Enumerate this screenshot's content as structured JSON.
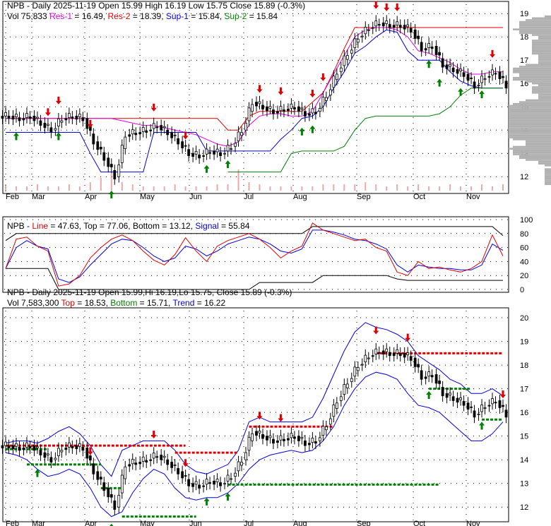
{
  "panel1": {
    "line1": {
      "title": "NPB - Daily 2025-11-19",
      "open": "Open 15.99",
      "high": "High 16.19",
      "low": "Low 15.75",
      "close": "Close 15.89 (-0.3%)"
    },
    "line2": {
      "vol": "Vol 75,833",
      "res1_label": "Res-1",
      "res1": "= 16.49,",
      "res2_label": "Res-2",
      "res2": "= 18.39,",
      "sup1_label": "Sup-1",
      "sup1": "= 15.84,",
      "sup2_label": "Sup-2",
      "sup2": "= 15.84"
    }
  },
  "panel2": {
    "prefix": "NPB -",
    "line_label": "Line",
    "line": "= 47.63,",
    "rest": "Top = 77.06, Bottom = 13.12,",
    "signal_label": "Signal",
    "signal": "= 55.84"
  },
  "panel3": {
    "line1": "NPB - Daily 2025-11-19 Open 15.99,Hi 16.19,Lo 15.75, Close 15.89 (-0.3%)",
    "line2": {
      "vol": "Vol 7,583,300",
      "top_label": "Top",
      "top": "= 18.53,",
      "bottom_label": "Bottom",
      "bottom": "= 15.71,",
      "trend_label": "Trend",
      "trend": "= 16.22"
    }
  },
  "colors": {
    "up": "#000000",
    "down": "#000000",
    "res1": "#e000e0",
    "res2": "#e00000",
    "sup1": "#0000e0",
    "sup2": "#008000",
    "line": "#e00000",
    "signal": "#0000e0",
    "arrow_up": "#008000",
    "arrow_down": "#e00000",
    "volume": "#c0c0c0"
  },
  "chart_data": [
    {
      "type": "candlestick",
      "title": "NPB - Daily 2025-11-19",
      "x_tick_labels": [
        "Feb",
        "Mar",
        "Apr",
        "May",
        "Jun",
        "Jul",
        "Aug",
        "Sep",
        "Oct",
        "Nov"
      ],
      "y_ticks": [
        12,
        13,
        14,
        15,
        16,
        17,
        18,
        19
      ],
      "ylim": [
        11.4,
        19.4
      ],
      "closes": [
        14.6,
        14.5,
        14.6,
        14.3,
        14.0,
        14.5,
        14.6,
        14.5,
        13.5,
        12.8,
        12.0,
        13.8,
        13.9,
        14.0,
        14.2,
        13.9,
        13.5,
        13.0,
        12.9,
        13.1,
        13.0,
        13.3,
        14.0,
        15.2,
        15.0,
        14.8,
        14.9,
        15.0,
        14.7,
        14.8,
        15.5,
        16.5,
        17.3,
        18.0,
        18.4,
        18.6,
        18.5,
        18.5,
        18.3,
        17.5,
        17.6,
        16.8,
        16.6,
        16.4,
        15.9,
        16.3,
        16.5,
        15.9
      ],
      "volume": [
        3,
        2,
        2,
        3,
        2,
        2,
        3,
        2,
        4,
        6,
        9,
        4,
        3,
        2,
        2,
        2,
        3,
        2,
        2,
        2,
        3,
        3,
        10,
        4,
        3,
        2,
        2,
        2,
        2,
        2,
        3,
        3,
        3,
        3,
        4,
        3,
        2,
        3,
        2,
        3,
        2,
        2,
        3,
        2,
        2,
        3,
        2,
        3
      ],
      "res1": [
        14.5,
        14.5,
        14.5,
        14.5,
        14.5,
        14.5,
        14.5,
        14.5,
        14.5,
        14.5,
        14.5,
        14.4,
        14.3,
        14.2,
        14.2,
        14.1,
        14.0,
        13.9,
        13.8,
        13.6,
        13.4,
        13.3,
        13.5,
        14.2,
        14.6,
        14.7,
        14.7,
        14.6,
        14.6,
        14.8,
        15.6,
        16.4,
        17.2,
        18.0,
        18.3,
        18.4,
        18.4,
        18.3,
        18.0,
        17.4,
        17.3,
        17.1,
        16.9,
        16.6,
        16.4,
        16.4,
        16.5,
        16.5
      ],
      "res2": [
        14.5,
        14.5,
        14.5,
        14.5,
        14.5,
        14.5,
        14.5,
        14.5,
        14.5,
        14.5,
        14.5,
        14.5,
        14.5,
        14.5,
        14.5,
        14.5,
        14.5,
        14.5,
        14.5,
        14.5,
        14.5,
        14.0,
        14.0,
        14.6,
        14.8,
        14.8,
        14.8,
        14.8,
        14.8,
        15.2,
        15.6,
        16.5,
        17.5,
        18.4,
        18.4,
        18.4,
        18.4,
        18.4,
        18.4,
        18.4,
        18.4,
        18.4,
        18.4,
        18.4,
        18.4,
        18.4,
        18.4,
        18.4
      ],
      "sup1": [
        13.9,
        13.9,
        13.9,
        13.9,
        13.9,
        13.9,
        13.9,
        13.9,
        13.0,
        12.2,
        12.2,
        12.2,
        12.2,
        12.2,
        13.9,
        13.9,
        13.9,
        13.9,
        13.9,
        13.1,
        13.1,
        13.1,
        13.1,
        13.1,
        13.1,
        13.1,
        13.6,
        14.0,
        14.5,
        14.6,
        15.0,
        15.8,
        16.5,
        17.3,
        17.6,
        18.0,
        18.3,
        18.2,
        17.4,
        17.0,
        17.0,
        17.0,
        16.5,
        16.1,
        15.9,
        15.8,
        15.8,
        15.8
      ],
      "sup2": [
        null,
        null,
        null,
        null,
        null,
        null,
        null,
        null,
        null,
        null,
        null,
        null,
        null,
        null,
        null,
        null,
        null,
        null,
        null,
        null,
        null,
        12.2,
        12.2,
        12.2,
        12.2,
        12.2,
        12.2,
        13.0,
        13.1,
        13.1,
        13.1,
        13.1,
        13.3,
        14.0,
        14.5,
        14.6,
        14.6,
        14.6,
        14.6,
        14.6,
        14.6,
        14.7,
        15.0,
        15.5,
        15.8,
        15.8,
        15.8,
        15.8
      ],
      "buy_signals": [
        1,
        5,
        10,
        19,
        21,
        28,
        29,
        40,
        41,
        43,
        45
      ],
      "sell_signals": [
        4,
        5,
        8,
        14,
        17,
        24,
        26,
        29,
        30,
        35,
        36,
        37,
        46
      ]
    },
    {
      "type": "line",
      "y_ticks": [
        0,
        20,
        40,
        60,
        80,
        100
      ],
      "ylim": [
        0,
        100
      ],
      "series": [
        {
          "name": "Line",
          "values": [
            30,
            72,
            75,
            62,
            55,
            5,
            8,
            20,
            45,
            60,
            72,
            78,
            70,
            55,
            42,
            35,
            50,
            74,
            55,
            40,
            62,
            70,
            75,
            80,
            72,
            60,
            45,
            55,
            62,
            95,
            85,
            80,
            75,
            70,
            72,
            60,
            55,
            25,
            20,
            40,
            30,
            32,
            28,
            25,
            30,
            40,
            78,
            48
          ]
        },
        {
          "name": "Signal",
          "values": [
            30,
            60,
            70,
            62,
            58,
            15,
            10,
            18,
            35,
            50,
            65,
            72,
            70,
            60,
            48,
            40,
            45,
            62,
            58,
            48,
            55,
            65,
            70,
            75,
            72,
            65,
            55,
            52,
            58,
            85,
            85,
            82,
            78,
            72,
            70,
            65,
            58,
            35,
            25,
            35,
            32,
            30,
            30,
            28,
            28,
            35,
            65,
            56
          ]
        },
        {
          "name": "Top",
          "values": [
            70,
            80,
            80,
            80,
            80,
            80,
            80,
            80,
            80,
            80,
            80,
            80,
            80,
            80,
            80,
            80,
            80,
            80,
            80,
            80,
            80,
            80,
            80,
            80,
            80,
            80,
            80,
            80,
            80,
            90,
            90,
            90,
            90,
            90,
            90,
            90,
            90,
            90,
            90,
            90,
            90,
            90,
            90,
            90,
            90,
            90,
            90,
            77
          ]
        },
        {
          "name": "Bottom",
          "values": [
            30,
            30,
            30,
            30,
            30,
            0,
            0,
            0,
            0,
            0,
            0,
            0,
            0,
            0,
            0,
            0,
            0,
            0,
            0,
            0,
            0,
            0,
            0,
            0,
            10,
            10,
            10,
            10,
            10,
            10,
            20,
            20,
            20,
            20,
            20,
            20,
            20,
            15,
            13,
            13,
            13,
            13,
            13,
            13,
            13,
            13,
            13,
            13
          ]
        }
      ]
    },
    {
      "type": "candlestick",
      "y_ticks": [
        12,
        13,
        14,
        15,
        16,
        17,
        18,
        19,
        20
      ],
      "ylim": [
        11.5,
        20.3
      ],
      "upper_band": [
        14.7,
        14.8,
        14.8,
        14.7,
        14.9,
        15.2,
        15.4,
        15.1,
        14.6,
        13.8,
        13.3,
        14.4,
        14.6,
        14.8,
        14.8,
        14.8,
        14.4,
        13.8,
        13.5,
        13.4,
        13.6,
        13.8,
        14.4,
        15.6,
        15.8,
        15.6,
        15.6,
        15.6,
        15.6,
        15.8,
        16.6,
        17.6,
        18.6,
        19.4,
        19.8,
        19.6,
        19.5,
        19.3,
        19.0,
        18.4,
        18.1,
        17.8,
        17.4,
        17.2,
        16.8,
        16.8,
        17.0,
        16.7
      ],
      "lower_band": [
        14.3,
        14.2,
        14.0,
        13.6,
        13.3,
        13.4,
        13.6,
        13.4,
        12.8,
        12.0,
        11.6,
        11.8,
        12.6,
        13.2,
        13.6,
        13.4,
        12.8,
        12.4,
        12.3,
        12.4,
        12.4,
        12.6,
        13.0,
        13.6,
        14.0,
        14.2,
        14.3,
        14.4,
        14.3,
        14.4,
        14.8,
        15.4,
        16.3,
        17.0,
        17.5,
        17.7,
        17.6,
        17.4,
        16.8,
        16.3,
        16.2,
        16.0,
        15.6,
        15.2,
        14.8,
        14.8,
        15.1,
        15.6
      ]
    }
  ]
}
